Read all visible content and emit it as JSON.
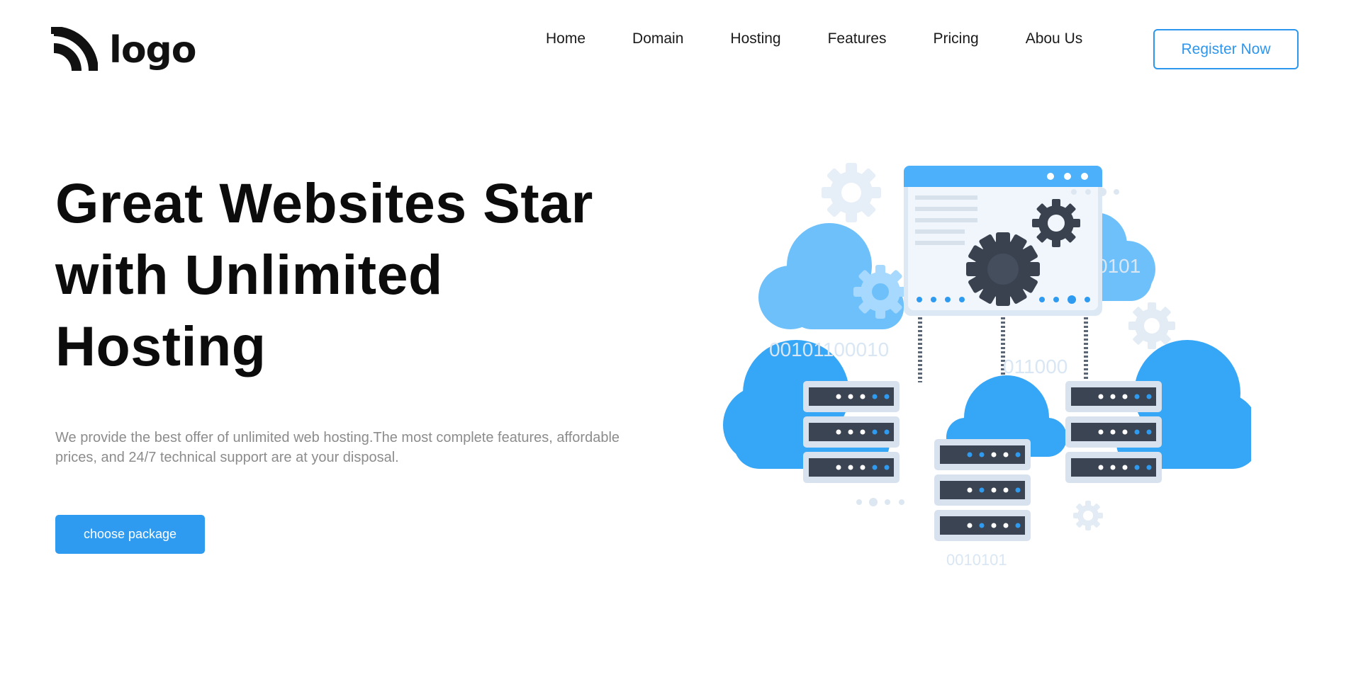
{
  "brand": {
    "logo_text": "logo"
  },
  "nav": {
    "items": [
      {
        "label": "Home"
      },
      {
        "label": "Domain"
      },
      {
        "label": "Hosting"
      },
      {
        "label": "Features"
      },
      {
        "label": "Pricing"
      },
      {
        "label": "Abou Us"
      }
    ],
    "register_label": "Register Now"
  },
  "hero": {
    "title": "Great Websites Star with Unlimited Hosting",
    "description": "We provide the best offer of unlimited web hosting.The most complete features, affordable prices, and 24/7 technical support are at your disposal.",
    "cta_label": "choose package"
  },
  "illustration": {
    "binary_texts": [
      "0101",
      "00101100010",
      "011000",
      "0010101"
    ]
  },
  "colors": {
    "accent": "#2e9bf0",
    "cloud": "#36a6f6",
    "cloud_light": "#7cc5fb",
    "server_dark": "#3b4453",
    "gear_dark": "#3a4250"
  }
}
